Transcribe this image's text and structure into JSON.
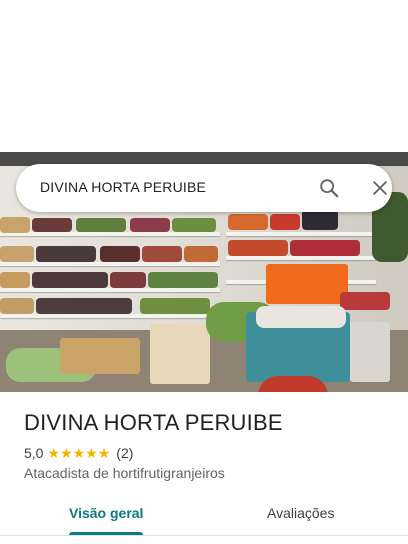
{
  "search": {
    "query": "DIVINA HORTA PERUIBE"
  },
  "place": {
    "name": "DIVINA HORTA PERUIBE",
    "rating": "5,0",
    "stars": 5,
    "review_count": "(2)",
    "category": "Atacadista de hortifrutigranjeiros"
  },
  "tabs": [
    {
      "label": "Visão geral",
      "active": true
    },
    {
      "label": "Avaliações",
      "active": false
    }
  ],
  "colors": {
    "accent": "#0a7b83",
    "star": "#f6b400"
  }
}
